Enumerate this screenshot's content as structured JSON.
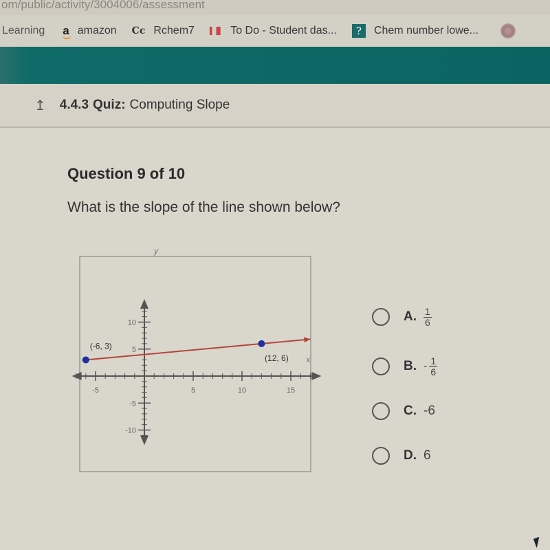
{
  "browser": {
    "url_fragment": "om/public/activity/3004006/assessment",
    "bookmarks": [
      {
        "label": "Learning",
        "icon": "none"
      },
      {
        "label": "amazon",
        "icon": "amazon-icon",
        "glyph": "a"
      },
      {
        "label": "Rchem7",
        "icon": "cc-icon",
        "glyph": "Cc"
      },
      {
        "label": "To Do - Student das...",
        "icon": "todo-icon",
        "glyph": "▌▐▌"
      },
      {
        "label": "Chem number lowe...",
        "icon": "question-mark-icon",
        "glyph": "?"
      }
    ]
  },
  "header": {
    "up_icon": "↥",
    "number": "4.4.3",
    "type": "Quiz:",
    "title": "Computing Slope"
  },
  "question": {
    "title": "Question 9 of 10",
    "text": "What is the slope of the line shown below?"
  },
  "options": [
    {
      "letter": "A.",
      "sign": "",
      "numerator": "1",
      "denominator": "6",
      "plain": ""
    },
    {
      "letter": "B.",
      "sign": "-",
      "numerator": "1",
      "denominator": "6",
      "plain": ""
    },
    {
      "letter": "C.",
      "sign": "",
      "numerator": "",
      "denominator": "",
      "plain": "-6"
    },
    {
      "letter": "D.",
      "sign": "",
      "numerator": "",
      "denominator": "",
      "plain": "6"
    }
  ],
  "colors": {
    "banner": "#0b6462",
    "line": "#b5453a",
    "point": "#1f2fa0"
  },
  "chart_data": {
    "type": "line",
    "title": "",
    "xlabel": "x",
    "ylabel": "y",
    "xlim": [
      -7,
      17
    ],
    "ylim": [
      -11,
      13
    ],
    "x_ticks": [
      -5,
      5,
      10,
      15
    ],
    "y_ticks": [
      10,
      5,
      -5,
      -10
    ],
    "grid": false,
    "points": [
      {
        "x": -6,
        "y": 3,
        "label": "(-6, 3)"
      },
      {
        "x": 12,
        "y": 6,
        "label": "(12, 6)"
      }
    ],
    "line": {
      "from": {
        "x": -6,
        "y": 3
      },
      "to_direction": "right",
      "extends_to_x": 17
    }
  }
}
